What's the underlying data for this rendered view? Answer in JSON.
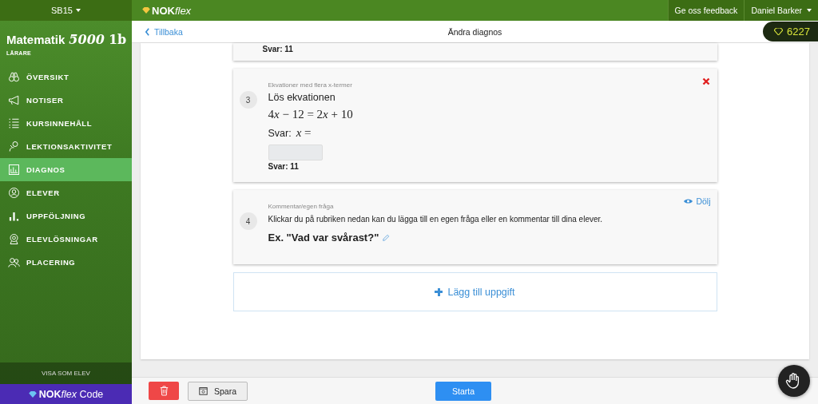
{
  "topbar": {
    "class_menu": "SB15",
    "logo": {
      "strong": "NOK",
      "light": "flex"
    },
    "feedback": "Ge oss feedback",
    "user": "Daniel Barker",
    "points": "6227"
  },
  "sidebar": {
    "course": {
      "name": "Matematik",
      "series": "5000",
      "level": "1b"
    },
    "role": "LÄRARE",
    "items": [
      {
        "label": "ÖVERSIKT",
        "selected": false
      },
      {
        "label": "NOTISER",
        "selected": false
      },
      {
        "label": "KURSINNEHÅLL",
        "selected": false
      },
      {
        "label": "LEKTIONSAKTIVITET",
        "selected": false
      },
      {
        "label": "DIAGNOS",
        "selected": true
      },
      {
        "label": "ELEVER",
        "selected": false
      },
      {
        "label": "UPPFÖLJNING",
        "selected": false
      },
      {
        "label": "ELEVLÖSNINGAR",
        "selected": false
      },
      {
        "label": "PLACERING",
        "selected": false
      }
    ],
    "view_as_student": "VISA SOM ELEV",
    "code_logo": {
      "strong": "NOK",
      "light": "flex",
      "suffix": "Code"
    }
  },
  "subheader": {
    "back": "Tillbaka",
    "title": "Ändra diagnos"
  },
  "tasks": [
    {
      "kind": "tail",
      "answer": "Svar: 11"
    },
    {
      "kind": "equation",
      "number": "3",
      "category": "Ekvationer med flera x-termer",
      "prompt": "Lös ekvationen",
      "equation": [
        {
          "kind": "number",
          "text": "4"
        },
        {
          "kind": "variable",
          "text": "x"
        },
        {
          "kind": "number",
          "text": " − 12 = 2"
        },
        {
          "kind": "variable",
          "text": "x"
        },
        {
          "kind": "number",
          "text": " + 10"
        }
      ],
      "answer_prefix": "Svar:",
      "answer_math": [
        {
          "kind": "variable",
          "text": "x"
        },
        {
          "kind": "number",
          "text": " ="
        }
      ],
      "answer": "Svar: 11",
      "removable": true
    },
    {
      "kind": "comment",
      "number": "4",
      "category": "Kommentar/egen fråga",
      "text": "Klickar du på rubriken nedan kan du lägga till en egen fråga eller en kommentar till dina elever.",
      "heading": "Ex. \"Vad var svårast?\"",
      "toggle": "Dölj"
    }
  ],
  "add_task": "Lägg till uppgift",
  "footer": {
    "save": "Spara",
    "start": "Starta"
  }
}
